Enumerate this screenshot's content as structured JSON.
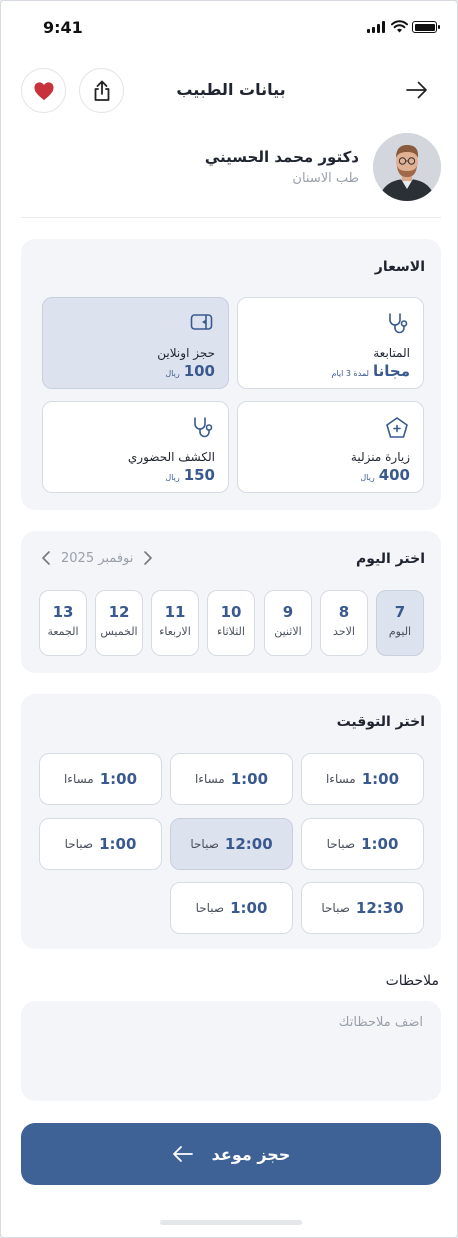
{
  "status_bar": {
    "time": "9:41"
  },
  "header": {
    "title": "بيانات الطبيب"
  },
  "doctor": {
    "name": "دكتور محمد الحسيني",
    "specialty": "طب الاسنان"
  },
  "prices": {
    "title": "الاسعار",
    "options": [
      {
        "label": "المتابعة",
        "value": "مجانا",
        "note": "لمدة 3 ايام",
        "icon": "stethoscope-icon",
        "selected": false
      },
      {
        "label": "حجز اونلاين",
        "value": "100",
        "note": "ريال",
        "icon": "video-icon",
        "selected": true
      },
      {
        "label": "زيارة منزلية",
        "value": "400",
        "note": "ريال",
        "icon": "home-visit-icon",
        "selected": false
      },
      {
        "label": "الكشف الحضوري",
        "value": "150",
        "note": "ريال",
        "icon": "stethoscope-icon",
        "selected": false
      }
    ]
  },
  "day_picker": {
    "title": "اختر اليوم",
    "month": "نوفمبر 2025",
    "days": [
      {
        "num": "7",
        "label": "اليوم",
        "selected": true
      },
      {
        "num": "8",
        "label": "الاحد",
        "selected": false
      },
      {
        "num": "9",
        "label": "الاثنين",
        "selected": false
      },
      {
        "num": "10",
        "label": "الثلاثاء",
        "selected": false
      },
      {
        "num": "11",
        "label": "الاربعاء",
        "selected": false
      },
      {
        "num": "12",
        "label": "الخميس",
        "selected": false
      },
      {
        "num": "13",
        "label": "الجمعة",
        "selected": false
      }
    ]
  },
  "time_picker": {
    "title": "اختر التوقيت",
    "slots": [
      {
        "time": "1:00",
        "period": "مساءا",
        "selected": false
      },
      {
        "time": "1:00",
        "period": "مساءا",
        "selected": false
      },
      {
        "time": "1:00",
        "period": "مساءا",
        "selected": false
      },
      {
        "time": "1:00",
        "period": "صباحا",
        "selected": false
      },
      {
        "time": "12:00",
        "period": "صباحا",
        "selected": true
      },
      {
        "time": "1:00",
        "period": "صباحا",
        "selected": false
      },
      {
        "time": "12:30",
        "period": "صباحا",
        "selected": false
      },
      {
        "time": "1:00",
        "period": "صباحا",
        "selected": false
      }
    ]
  },
  "notes": {
    "label": "ملاحظات",
    "placeholder": "اضف ملاحظاتك"
  },
  "book_button": {
    "label": "حجز موعد"
  },
  "colors": {
    "primary": "#3f6296",
    "accent_text": "#3a5a8f",
    "selected_bg": "#dde3ee",
    "card_bg": "#f3f5f9",
    "favorite": "#c8323c"
  }
}
